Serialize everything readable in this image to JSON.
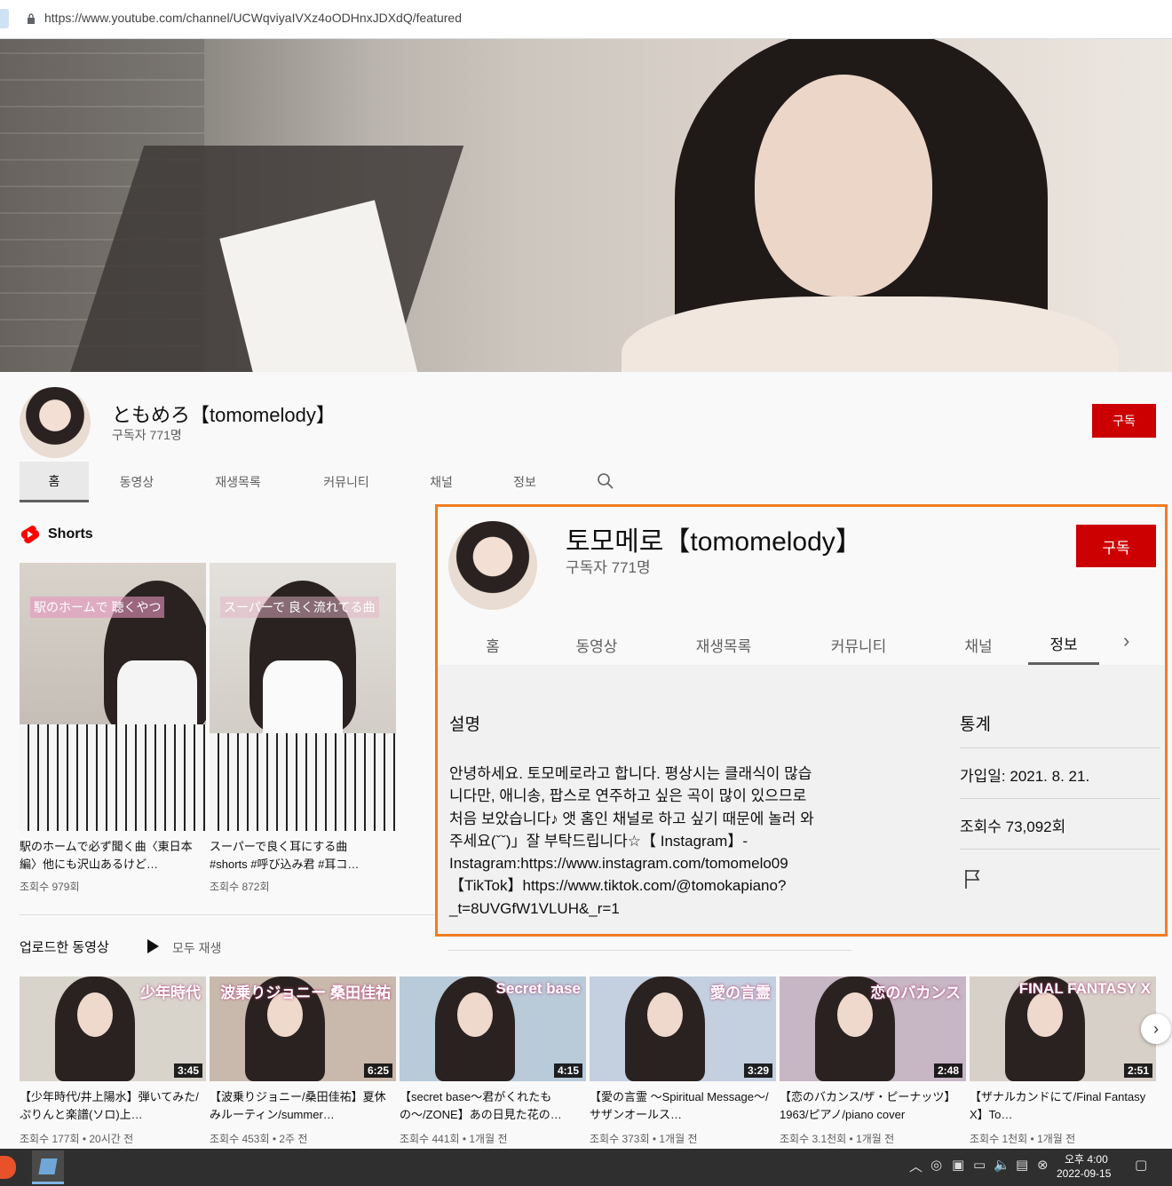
{
  "browser": {
    "url": "https://www.youtube.com/channel/UCWqviyaIVXz4oODHnxJDXdQ/featured"
  },
  "channel": {
    "title": "ともめろ【tomomelody】",
    "subscribers": "구독자 771명",
    "subscribe_label": "구독",
    "tabs": [
      "홈",
      "동영상",
      "재생목록",
      "커뮤니티",
      "채널",
      "정보"
    ]
  },
  "shorts": {
    "heading": "Shorts",
    "items": [
      {
        "title": "駅のホームで必ず聞く曲〈東日本編〉他にも沢山あるけど…",
        "views": "조회수 979회",
        "overlay": "駅のホームで 聴くやつ"
      },
      {
        "title": "スーパーで良く耳にする曲 #shorts #呼び込み君 #耳コ…",
        "views": "조회수 872회",
        "overlay": "スーパーで 良く流れてる曲"
      }
    ]
  },
  "uploads": {
    "heading": "업로드한 동영상",
    "play_all": "모두 재생",
    "videos": [
      {
        "title": "【少年時代/井上陽水】弾いてみた/ぷりんと楽譜(ソロ)上…",
        "meta": "조회수 177회 • 20시간 전",
        "duration": "3:45",
        "overlay": "少年時代",
        "bg": "#d8d4cc"
      },
      {
        "title": "【波乗りジョニー/桑田佳祐】夏休みルーティン/summer…",
        "meta": "조회수 453회 • 2주 전",
        "duration": "6:25",
        "overlay": "波乗りジョニー 桑田佳祐",
        "bg": "#c9b9ad"
      },
      {
        "title": "【secret base〜君がくれたもの〜/ZONE】あの日見た花の…",
        "meta": "조회수 441회 • 1개월 전",
        "duration": "4:15",
        "overlay": "Secret base",
        "bg": "#b9cad8"
      },
      {
        "title": "【愛の言霊 〜Spiritual Message〜/サザンオールス…",
        "meta": "조회수 373회 • 1개월 전",
        "duration": "3:29",
        "overlay": "愛の言霊",
        "bg": "#c4cfdf"
      },
      {
        "title": "【恋のバカンス/ザ・ピーナッツ】1963/ピアノ/piano cover",
        "meta": "조회수 3.1천회 • 1개월 전",
        "duration": "2:48",
        "overlay": "恋のバカンス",
        "bg": "#c7b6c4"
      },
      {
        "title": "【ザナルカンドにて/Final Fantasy X】To…",
        "meta": "조회수 1천회 • 1개월 전",
        "duration": "2:51",
        "overlay": "FINAL FANTASY X",
        "bg": "#d6d0c8"
      }
    ]
  },
  "about_panel": {
    "title": "토모메로【tomomelody】",
    "subscribers": "구독자 771명",
    "subscribe_label": "구독",
    "tabs": [
      "홈",
      "동영상",
      "재생목록",
      "커뮤니티",
      "채널",
      "정보"
    ],
    "description_heading": "설명",
    "description_lines": [
      "안녕하세요. 토모메로라고 합니다. 평상시는 클래식이 많습",
      "니다만, 애니송, 팝스로 연주하고 싶은 곡이 많이 있으므로",
      "처음 보았습니다♪ 앳 홈인 채널로 하고 싶기 때문에 놀러 와",
      "주세요(ˇˇ)」잘 부탁드립니다☆【 Instagram】-",
      "Instagram:https://www.instagram.com/tomomelo09",
      "【TikTok】https://www.tiktok.com/@tomokapiano?",
      "_t=8UVGfW1VLUH&_r=1"
    ],
    "stats_heading": "통계",
    "joined": "가입일: 2021. 8. 21.",
    "views": "조회수 73,092회",
    "accent": "#f07d21"
  },
  "taskbar": {
    "time": "오후 4:00",
    "date": "2022-09-15"
  }
}
